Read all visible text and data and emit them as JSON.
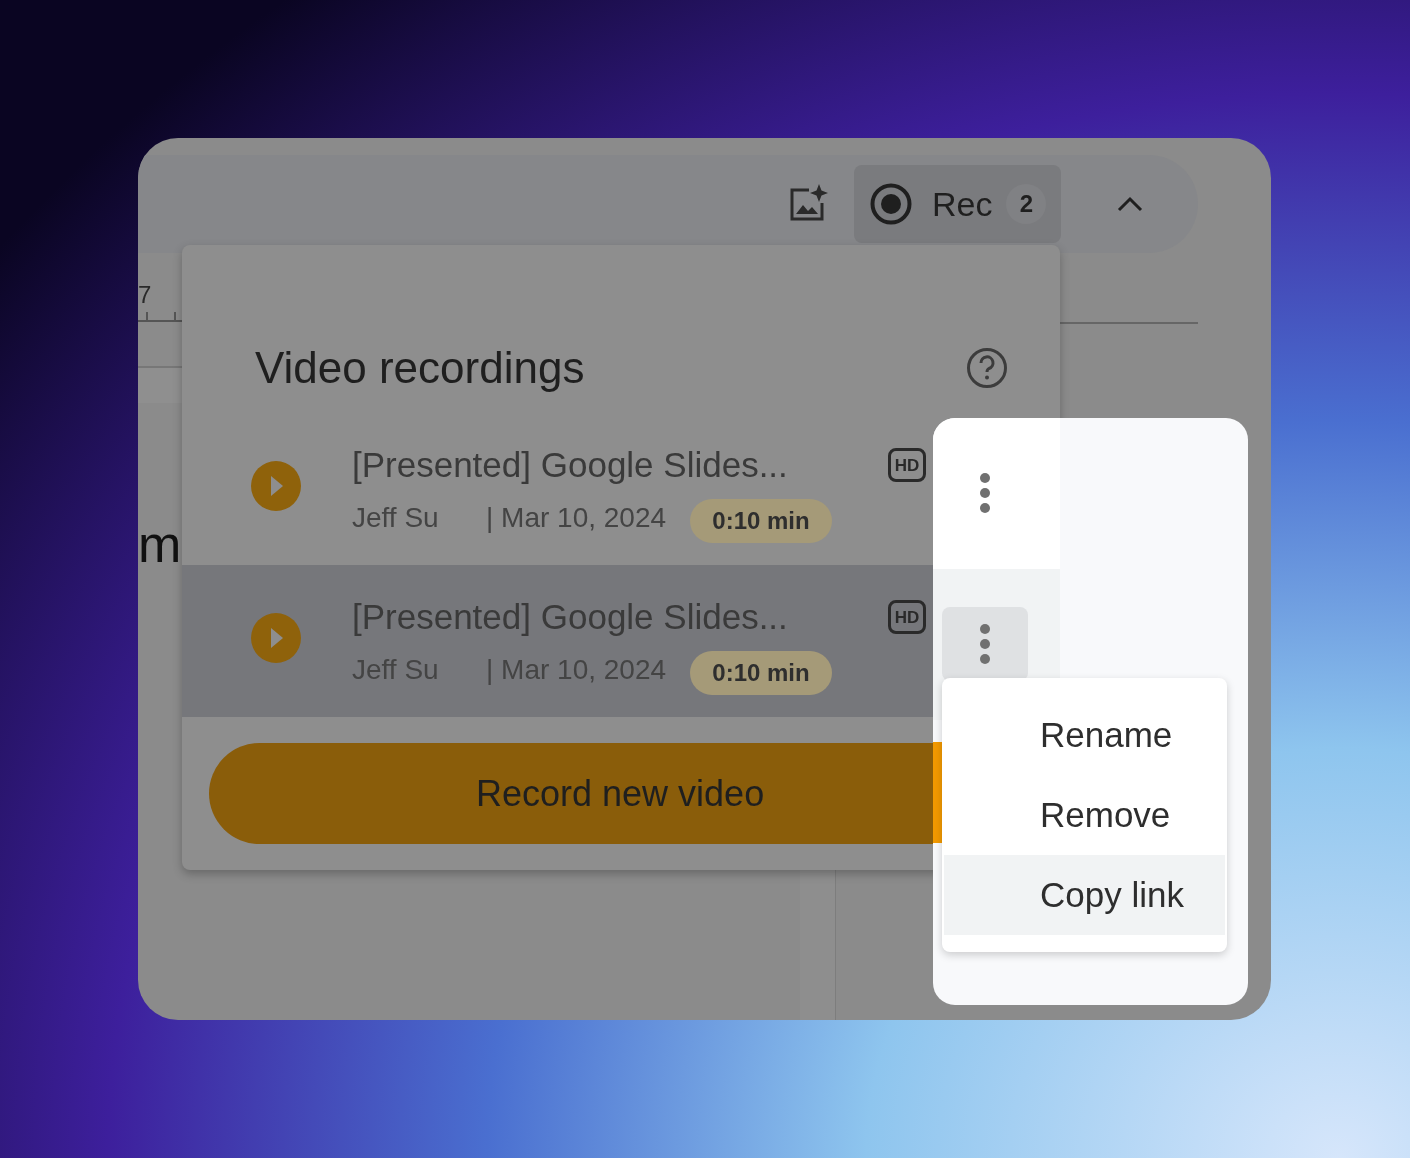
{
  "toolbar": {
    "rec_label": "Rec",
    "rec_count": "2"
  },
  "ruler": {
    "label": "7"
  },
  "document": {
    "text_fragment": "m"
  },
  "panel": {
    "title": "Video recordings",
    "recordings": [
      {
        "title": "[Presented] Google Slides...",
        "author": "Jeff Su",
        "date": "| Mar 10, 2024",
        "duration": "0:10 min",
        "badge": "HD",
        "selected": false
      },
      {
        "title": "[Presented] Google Slides...",
        "author": "Jeff Su",
        "date": "| Mar 10, 2024",
        "duration": "0:10 min",
        "badge": "HD",
        "selected": true
      }
    ],
    "record_button": "Record new video"
  },
  "context_menu": {
    "items": [
      {
        "label": "Rename",
        "selected": false
      },
      {
        "label": "Remove",
        "selected": false
      },
      {
        "label": "Copy link",
        "selected": true
      }
    ]
  }
}
